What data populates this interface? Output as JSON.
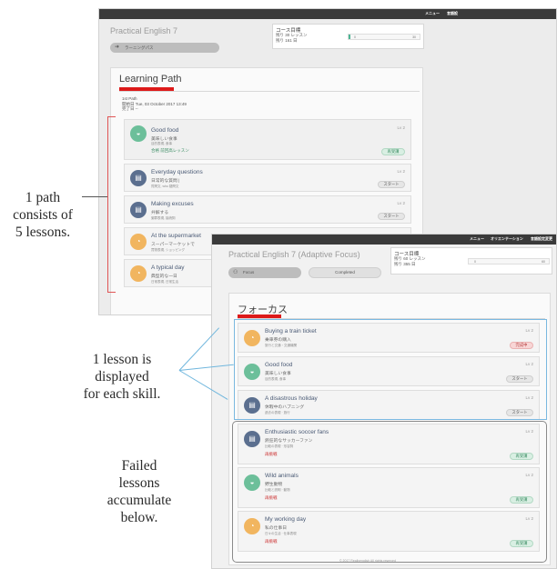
{
  "back_screen": {
    "topbar": {
      "menu": "メニュー",
      "extra": "言語設"
    },
    "course_title": "Practical English 7",
    "pill_label": "ラーニングパス",
    "goal": {
      "title": "コース目標",
      "remaining_lessons": "残り 30 レッスン",
      "remaining_days": "残り 161 日",
      "bar_left": "0",
      "bar_right": "30"
    },
    "panel_title": "Learning Path",
    "meta": {
      "line1": "1st Path",
      "line2": "開始日 Tue, 03 October 2017 13:49",
      "line3": "完了日 --"
    },
    "lessons": [
      {
        "title": "Good food",
        "subtitle": "美味しい食事",
        "tags": "目的表現, 食事",
        "status": "合格  前回高レッスン",
        "meta": "Lv 2",
        "button": "再受講"
      },
      {
        "title": "Everyday questions",
        "subtitle": "日常的な質問 |",
        "tags": "質問文, who 疑問文",
        "status": "",
        "meta": "Lv 2",
        "button": "スタート"
      },
      {
        "title": "Making excuses",
        "subtitle": "弁解する",
        "tags": "謝罪表現, 接続詞",
        "status": "",
        "meta": "Lv 2",
        "button": "スタート"
      },
      {
        "title": "At the supermarket",
        "subtitle": "スーパーマーケットで",
        "tags": "買物表現, ショッピング",
        "status": "",
        "meta": "Lv 2",
        "button": ""
      },
      {
        "title": "A typical day",
        "subtitle": "典型的な一日",
        "tags": "日常表現, 日常生活",
        "status": "",
        "meta": "Lv 2",
        "button": ""
      }
    ],
    "colors": {
      "green": "#6cbf9a",
      "blue": "#5b6f8f",
      "orange": "#f1b55f"
    }
  },
  "front_screen": {
    "topbar": {
      "menu": "メニュー",
      "orientation": "オリエンテーション",
      "lang": "言語設定変更"
    },
    "course_title": "Practical English 7 (Adaptive Focus)",
    "tabs": {
      "focus": "Focus",
      "completed": "Completed"
    },
    "goal": {
      "title": "コース目標",
      "remaining_lessons": "残り 60 レッスン",
      "remaining_days": "残り 355 日",
      "bar_left": "0",
      "bar_right": "60"
    },
    "panel_title": "フォーカス",
    "lessons": [
      {
        "title": "Buying a train ticket",
        "subtitle": "乗車券の購入",
        "tags": "旅行と交通・交通機関",
        "status": "",
        "meta": "Lv 2",
        "button": "完成中"
      },
      {
        "title": "Good food",
        "subtitle": "美味しい食事",
        "tags": "目的表現, 食事",
        "status": "",
        "meta": "Lv 2",
        "button": "スタート"
      },
      {
        "title": "A disastrous holiday",
        "subtitle": "休暇中のハプニング",
        "tags": "過去の表現 · 旅行",
        "status": "",
        "meta": "Lv 2",
        "button": "スタート"
      },
      {
        "title": "Enthusiastic soccer fans",
        "subtitle": "熱狂的なサッカーファン",
        "tags": "比較の表現 · 形容詞",
        "status": "再挑戦",
        "meta": "Lv 2",
        "button": "再受講"
      },
      {
        "title": "Wild animals",
        "subtitle": "野生動物",
        "tags": "比較と説明 · 動物",
        "status": "再挑戦",
        "meta": "Lv 2",
        "button": "再受講"
      },
      {
        "title": "My working day",
        "subtitle": "私の仕事日",
        "tags": "日々の生活 · 仕事表現",
        "status": "再挑戦",
        "meta": "Lv 2",
        "button": "再受講"
      }
    ],
    "footer": "© 2017 Reallyenglish All rights reserved"
  },
  "annotations": {
    "path": [
      "1 path",
      "consists of",
      "5 lessons."
    ],
    "lesson": [
      "1 lesson is",
      "displayed",
      "for each skill."
    ],
    "failed": [
      "Failed",
      "lessons",
      "accumulate",
      "below."
    ]
  }
}
